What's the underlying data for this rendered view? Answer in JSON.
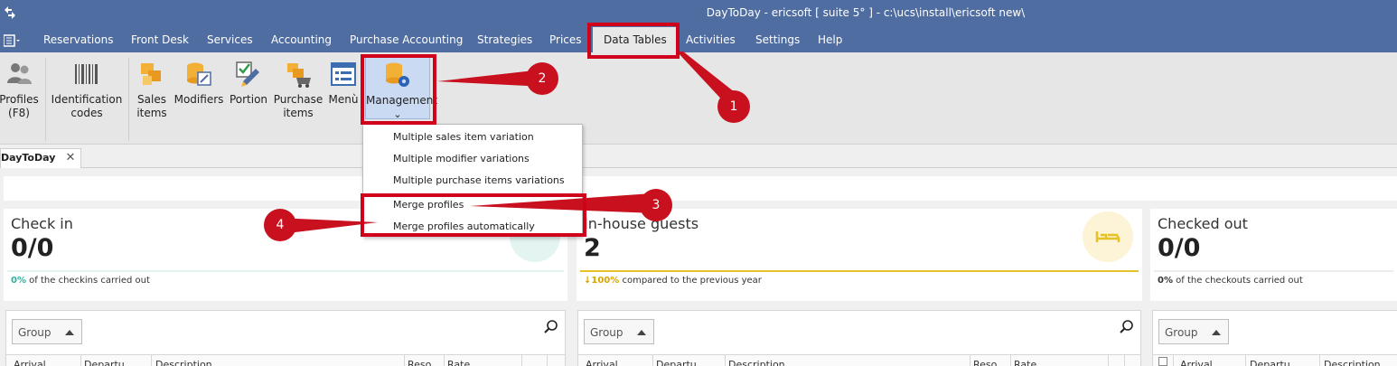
{
  "window": {
    "title": "DayToDay - ericsoft [ suite 5° ] - c:\\ucs\\install\\ericsoft new\\"
  },
  "menu": {
    "items": [
      "Reservations",
      "Front Desk",
      "Services",
      "Accounting",
      "Purchase Accounting",
      "Strategies",
      "Prices",
      "Data Tables",
      "Activities",
      "Settings",
      "Help"
    ],
    "active": "Data Tables"
  },
  "ribbon": {
    "profiles": "Profiles (F8)",
    "identification_codes": "Identification codes",
    "sales_items": "Sales items",
    "modifiers": "Modifiers",
    "portion": "Portion",
    "purchase_items": "Purchase items",
    "menu": "Menù",
    "management": "Management",
    "management_chevron": "⌄"
  },
  "management_menu": {
    "items": [
      "Multiple sales item variation",
      "Multiple modifier variations",
      "Multiple purchase items variations",
      "Merge profiles",
      "Merge profiles automatically"
    ]
  },
  "tabs": [
    {
      "label": "DayToDay",
      "close": "✕"
    }
  ],
  "cards": [
    {
      "title": "Check in",
      "value": "0/0",
      "note_pct": "0%",
      "note_text": "of the checkins carried out"
    },
    {
      "title": "In-house guests",
      "value": "2",
      "note_pct": "↓100%",
      "note_text": "compared to the previous year"
    },
    {
      "title": "Checked out",
      "value": "0/0",
      "note_pct": "0%",
      "note_text": "of the checkouts carried out"
    }
  ],
  "grids": [
    {
      "group_label": "Group",
      "columns": [
        "Arrival",
        "Departu",
        "Description",
        "Reso",
        "Rate"
      ]
    },
    {
      "group_label": "Group",
      "columns": [
        "Arrival",
        "Departu",
        "Description",
        "Reso",
        "Rate"
      ]
    },
    {
      "group_label": "Group",
      "columns": [
        "Arrival",
        "Departu",
        "Description"
      ]
    }
  ],
  "annotations": [
    "1",
    "2",
    "3",
    "4"
  ],
  "colors": {
    "titlebar": "#4f6da0",
    "highlight": "#d0021b",
    "marker": "#c8101e",
    "checkin_accent": "#2bb3a0",
    "inhouse_accent": "#e6c229"
  }
}
